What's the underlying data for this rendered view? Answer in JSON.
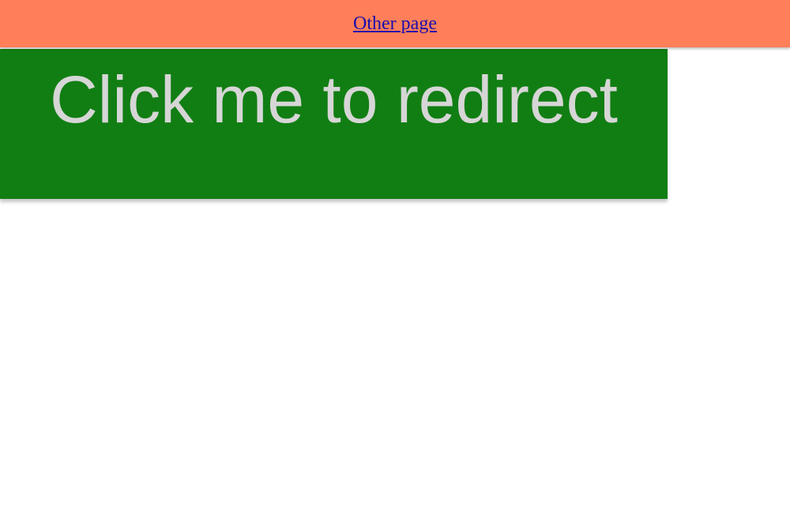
{
  "header": {
    "link_label": "Other page"
  },
  "main": {
    "redirect_button_label": "Click me to redirect"
  },
  "colors": {
    "header_bg": "#ff7f5a",
    "button_bg": "#117e13",
    "button_text": "#d6d6d6",
    "link": "#1a0dab"
  }
}
